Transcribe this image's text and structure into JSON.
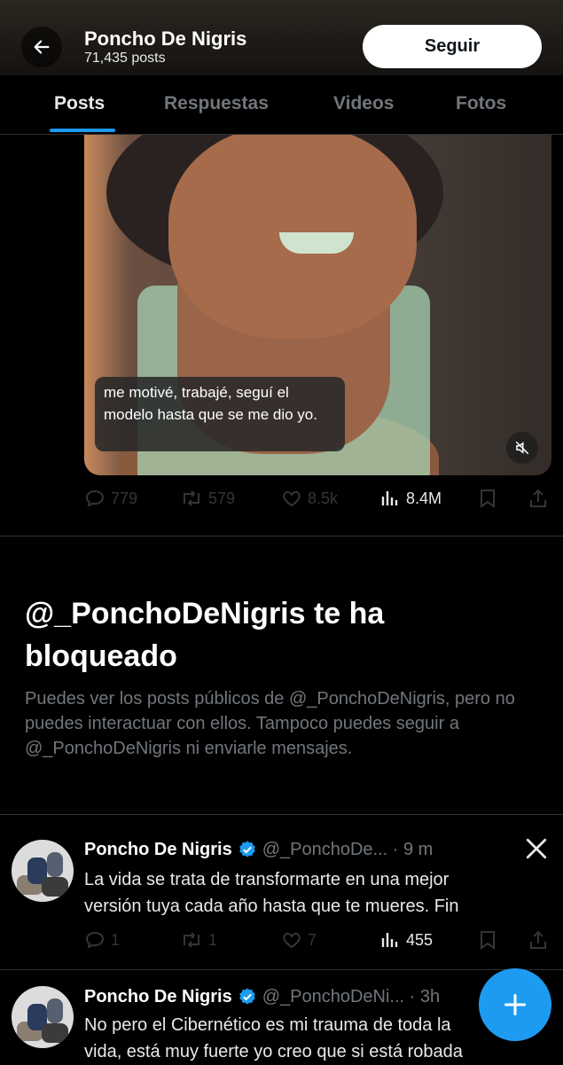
{
  "header": {
    "name": "Poncho De Nigris",
    "post_count": "71,435 posts",
    "follow_label": "Seguir",
    "back_icon": "arrow-left-icon"
  },
  "tabs": [
    {
      "label": "Posts",
      "active": true
    },
    {
      "label": "Respuestas",
      "active": false
    },
    {
      "label": "Videos",
      "active": false
    },
    {
      "label": "Fotos",
      "active": false
    }
  ],
  "media_post": {
    "caption": "me motivé, trabajé, seguí el modelo hasta que se me dio yo.",
    "mute_icon": "muted-speaker-icon",
    "replies": "779",
    "reposts": "579",
    "likes": "8.5k",
    "views": "8.4M"
  },
  "block_notice": {
    "title": "@_PonchoDeNigris te ha bloqueado",
    "description": "Puedes ver los posts públicos de @_PonchoDeNigris, pero no puedes interactuar con ellos. Tampoco puedes seguir a @_PonchoDeNigris ni enviarle mensajes."
  },
  "posts": [
    {
      "name": "Poncho De Nigris",
      "handle_time": "@_PonchoDe... · 9 m",
      "line1": "La vida se trata de transformarte en una mejor",
      "line2": "versión tuya cada año hasta que te mueres. Fin",
      "replies": "1",
      "reposts": "1",
      "likes": "7",
      "views": "455"
    },
    {
      "name": "Poncho De Nigris",
      "handle_time": "@_PonchoDeNi... · 3h",
      "line1": "No pero el Cibernético es mi trauma de toda la",
      "line2": "vida, está muy fuerte yo creo que si está robada"
    }
  ],
  "colors": {
    "accent": "#1d9bf0",
    "background": "#000000",
    "muted_text": "#71767b",
    "separator": "#2f3336"
  }
}
